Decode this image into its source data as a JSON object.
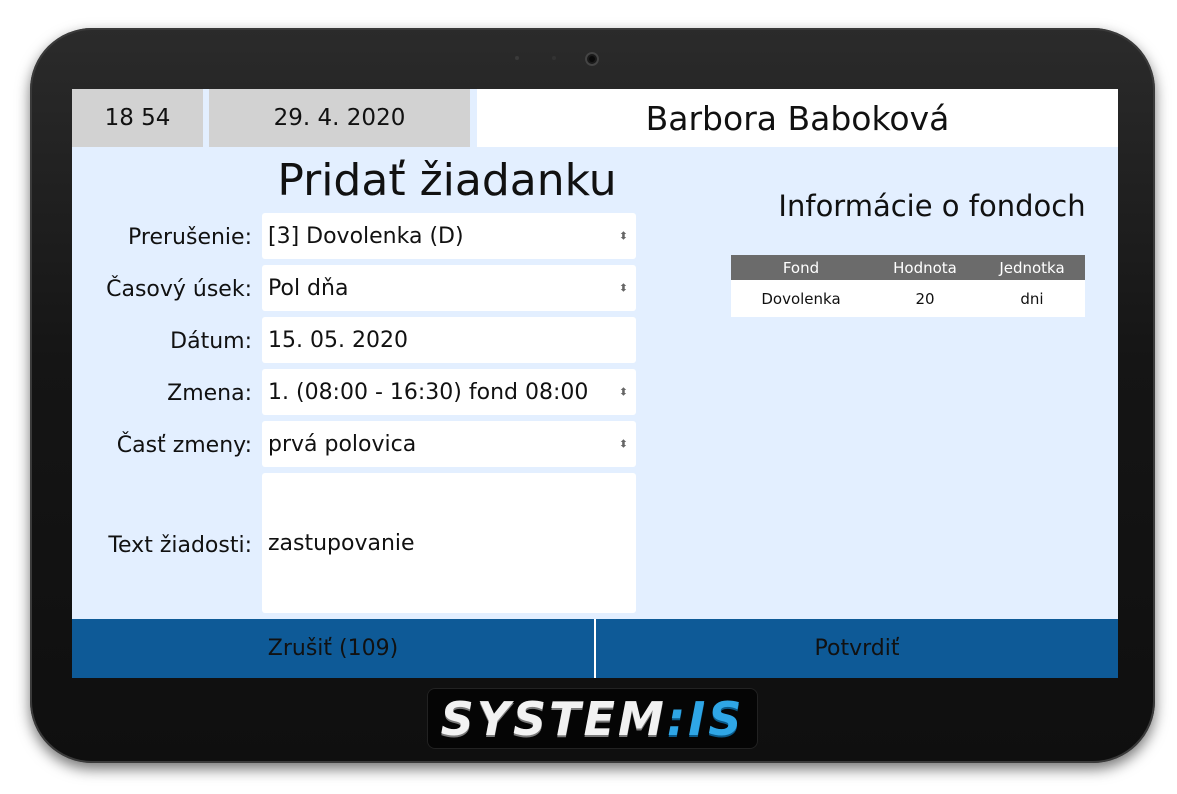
{
  "header": {
    "time": "18 54",
    "date": "29. 4. 2020",
    "user_name": "Barbora Baboková"
  },
  "form": {
    "title": "Pridať žiadanku",
    "fields": [
      {
        "label": "Prerušenie:",
        "value": "[3] Dovolenka (D)",
        "type": "select"
      },
      {
        "label": "Časový úsek:",
        "value": "Pol dňa",
        "type": "select"
      },
      {
        "label": "Dátum:",
        "value": "15. 05. 2020",
        "type": "date"
      },
      {
        "label": "Zmena:",
        "value": "1.  (08:00 - 16:30) fond 08:00",
        "type": "select"
      },
      {
        "label": "Časť zmeny:",
        "value": "prvá polovica",
        "type": "select"
      },
      {
        "label": "Text žiadosti:",
        "value": "zastupovanie",
        "type": "textarea"
      }
    ]
  },
  "funds": {
    "title": "Informácie o fondoch",
    "columns": [
      "Fond",
      "Hodnota",
      "Jednotka"
    ],
    "rows": [
      [
        "Dovolenka",
        "20",
        "dni"
      ]
    ]
  },
  "buttons": {
    "cancel": "Zrušiť (109)",
    "confirm": "Potvrdiť"
  },
  "logo": {
    "part1": "SYSTEM",
    "part2": "IS"
  },
  "colors": {
    "screen_bg": "#e3efff",
    "header_bg": "#d2d2d2",
    "button_bg": "#0e5a97",
    "table_header_bg": "#6b6b6b",
    "logo_accent": "#2fa6e6"
  }
}
